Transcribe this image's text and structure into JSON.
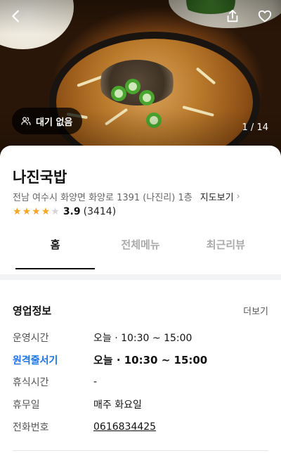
{
  "hero": {
    "photo_counter": "1 / 14",
    "wait_status": "대기 없음",
    "icons": {
      "back": "back-arrow-icon",
      "share": "share-icon",
      "favorite": "heart-icon",
      "wait": "people-icon"
    }
  },
  "store": {
    "name": "나진국밥",
    "address": "전남 여수시 화양면 화양로 1391 (나진리) 1층",
    "map_link": "지도보기",
    "rating": 3.9,
    "rating_text": "3.9",
    "review_count_text": "(3414)",
    "colors": {
      "star": "#f5a623",
      "accent": "#1a73e8"
    }
  },
  "tabs": [
    {
      "label": "홈",
      "active": true
    },
    {
      "label": "전체메뉴",
      "active": false
    },
    {
      "label": "최근리뷰",
      "active": false
    }
  ],
  "business_info": {
    "title": "영업정보",
    "more_label": "더보기",
    "rows": [
      {
        "key": "운영시간",
        "value": "오늘 · 10:30 ~ 15:00"
      },
      {
        "key": "원격줄서기",
        "value": "오늘 · 10:30 ~ 15:00"
      },
      {
        "key": "휴식시간",
        "value": "-"
      },
      {
        "key": "휴무일",
        "value": "매주 화요일"
      },
      {
        "key": "전화번호",
        "value": "0616834425"
      }
    ]
  }
}
